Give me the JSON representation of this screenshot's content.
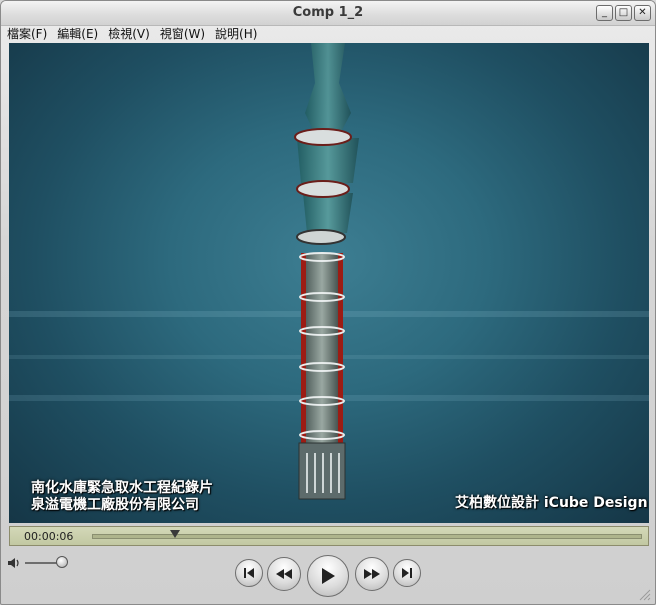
{
  "window": {
    "title": "Comp 1_2",
    "buttons": {
      "minimize": "_",
      "maximize": "□",
      "close": "✕"
    }
  },
  "menu": {
    "items": [
      "檔案(F)",
      "編輯(E)",
      "檢視(V)",
      "視窗(W)",
      "說明(H)"
    ]
  },
  "video": {
    "caption_left_line1": "南化水庫緊急取水工程紀錄片",
    "caption_left_line2": "泉溢電機工廠股份有限公司",
    "caption_right": "艾柏數位設計 iCube Design",
    "colors": {
      "background_center": "#3d7e92",
      "background_edge": "#153646",
      "pipe_red": "#9c1c14"
    }
  },
  "playback": {
    "timecode": "00:00:06",
    "position_fraction": 0.15,
    "volume_fraction": 0.9
  },
  "icons": {
    "volume": "speaker-icon",
    "go_to_start": "skip-back-icon",
    "rewind": "rewind-icon",
    "play": "play-icon",
    "fast_forward": "fast-forward-icon",
    "go_to_end": "skip-forward-icon"
  }
}
